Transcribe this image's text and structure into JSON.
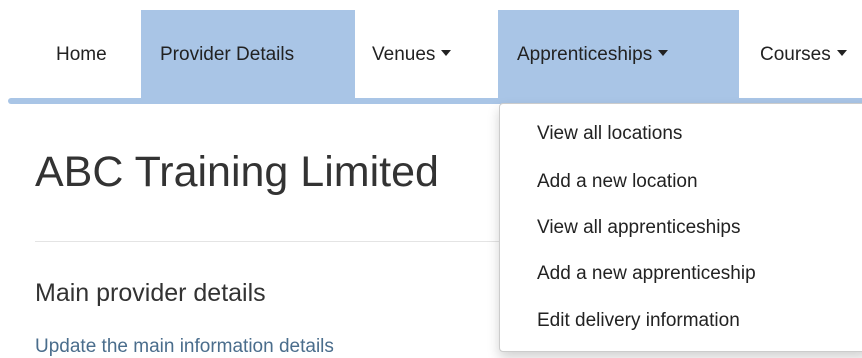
{
  "nav": {
    "items": [
      {
        "label": "Home",
        "has_caret": false,
        "active": false
      },
      {
        "label": "Provider Details",
        "has_caret": false,
        "active": true
      },
      {
        "label": "Venues",
        "has_caret": true,
        "active": false
      },
      {
        "label": "Apprenticeships",
        "has_caret": true,
        "active": true
      },
      {
        "label": "Courses",
        "has_caret": true,
        "active": false
      }
    ],
    "accent_color": "#a9c5e6"
  },
  "main": {
    "title": "ABC Training Limited",
    "section_title": "Main provider details",
    "section_description": "Update the main information details"
  },
  "dropdown": {
    "items": [
      {
        "label": "View all locations"
      },
      {
        "label": "Add a new location"
      },
      {
        "label": "View all apprenticeships"
      },
      {
        "label": "Add a new apprenticeship"
      },
      {
        "label": "Edit delivery information"
      }
    ]
  }
}
